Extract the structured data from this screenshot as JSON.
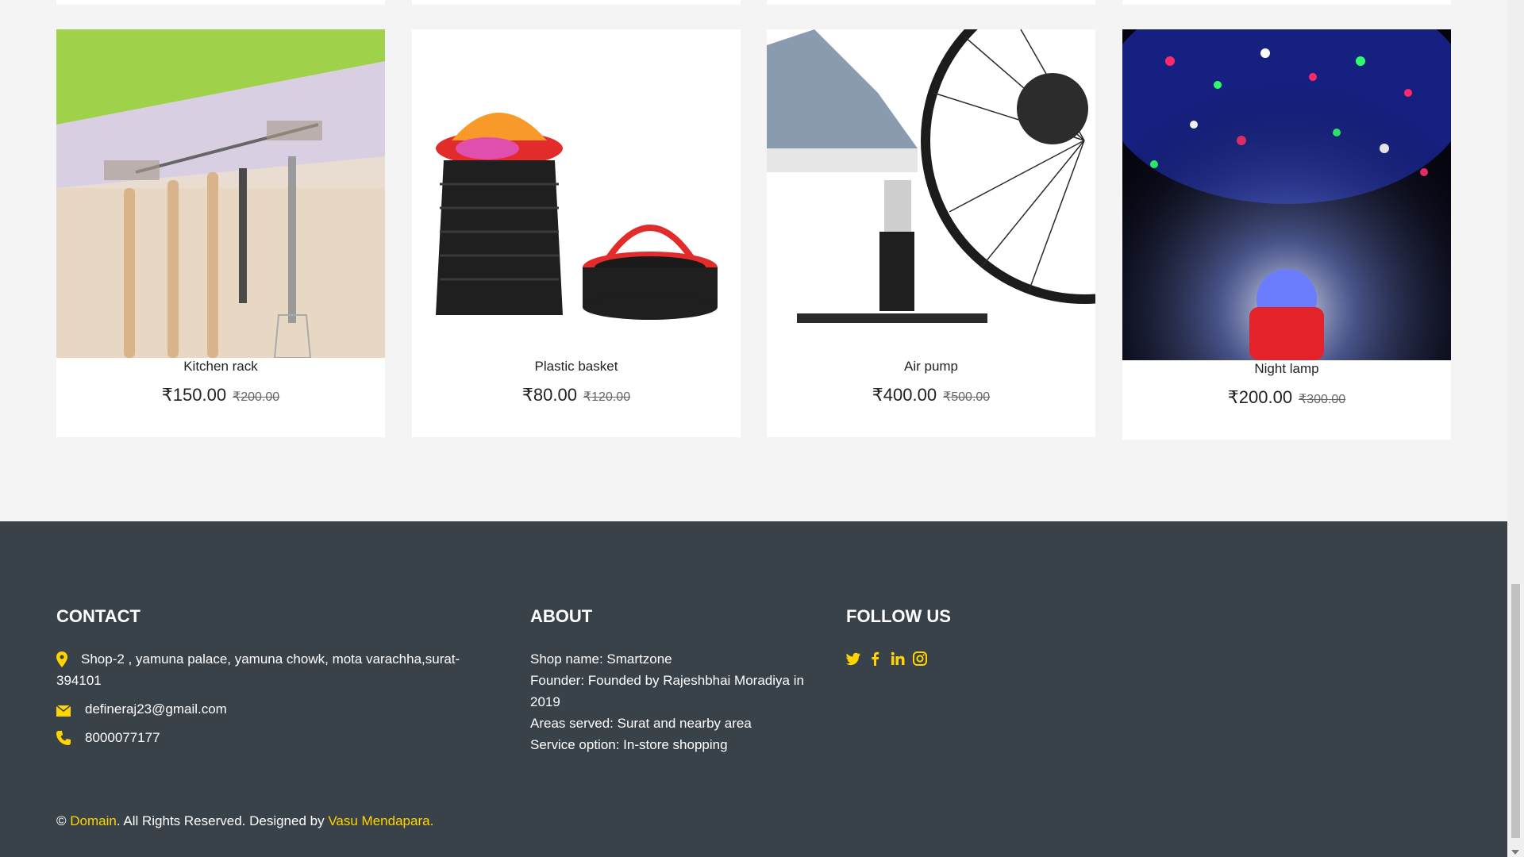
{
  "products": [
    {
      "name": "Kitchen rack",
      "price": "₹150.00",
      "old_price": "₹200.00"
    },
    {
      "name": "Plastic basket",
      "price": "₹80.00",
      "old_price": "₹120.00"
    },
    {
      "name": "Air pump",
      "price": "₹400.00",
      "old_price": "₹500.00"
    },
    {
      "name": "Night lamp",
      "price": "₹200.00",
      "old_price": "₹300.00"
    }
  ],
  "footer": {
    "contact": {
      "title": "CONTACT",
      "address": "Shop-2 , yamuna palace, yamuna chowk, mota varachha,surat-394101",
      "email": "defineraj23@gmail.com",
      "phone": "8000077177"
    },
    "about": {
      "title": "ABOUT",
      "line1": "Shop name: Smartzone",
      "line2": "Founder: Founded by Rajeshbhai Moradiya in 2019",
      "line3": "Areas served: Surat and nearby area",
      "line4": "Service option: In-store shopping"
    },
    "follow": {
      "title": "FOLLOW US",
      "icons": [
        "twitter-icon",
        "facebook-icon",
        "linkedin-icon",
        "instagram-icon"
      ]
    },
    "copyright": {
      "prefix": "©",
      "domain_link": "Domain",
      "middle": ". All Rights Reserved. Designed by",
      "designer_link": "Vasu Mendapara",
      "suffix": "."
    }
  },
  "colors": {
    "accent": "#ffd400",
    "footer_bg": "#3a4249",
    "page_bg": "#f4f4f4"
  }
}
